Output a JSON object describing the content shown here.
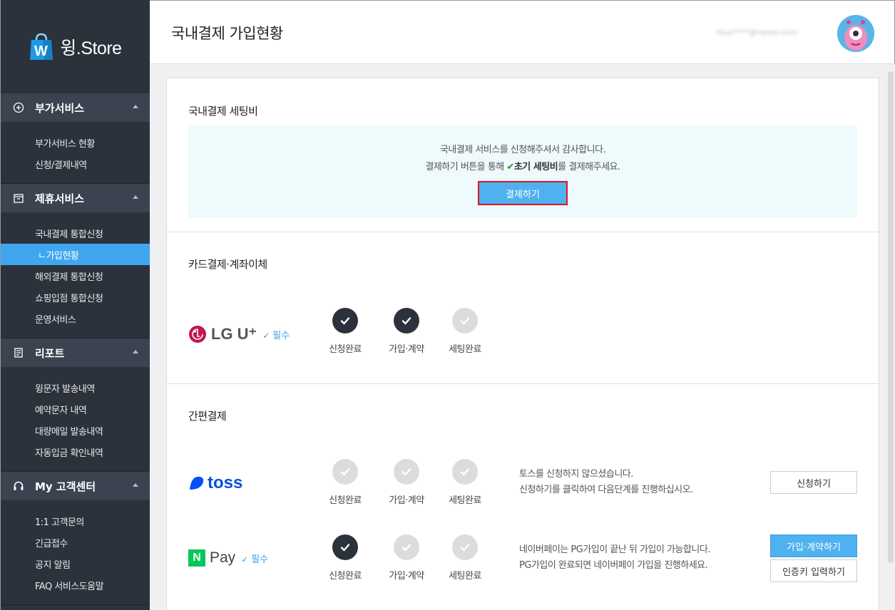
{
  "brand": {
    "name": "윙.Store",
    "bag_letter": "W"
  },
  "header": {
    "title": "국내결제 가입현황",
    "email": "hiuz****@naver.com"
  },
  "sidebar": {
    "sections": [
      {
        "title": "부가서비스",
        "icon": "plus-circle-icon",
        "items": [
          "부가서비스 현황",
          "신청/결제내역"
        ]
      },
      {
        "title": "제휴서비스",
        "icon": "box-icon",
        "items": [
          "국내결제 통합신청",
          "ㄴ가입현황",
          "해외결제 통합신청",
          "쇼핑입점 통합신청",
          "운영서비스"
        ],
        "active_index": 1
      },
      {
        "title": "리포트",
        "icon": "report-icon",
        "items": [
          "윙문자 발송내역",
          "예약문자 내역",
          "대량메일 발송내역",
          "자동입금 확인내역"
        ]
      },
      {
        "title": "My 고객센터",
        "icon": "headset-icon",
        "items": [
          "1:1 고객문의",
          "긴급접수",
          "공지 알림",
          "FAQ 서비스도움말"
        ]
      }
    ]
  },
  "setup": {
    "title": "국내결제 세팅비",
    "line1": "국내결제 서비스를 신청해주셔서 감사합니다.",
    "line2_pre": "결제하기 버튼을 통해 ",
    "line2_check": "✔",
    "line2_bold": "초기 세팅비",
    "line2_post": "를 결제해주세요.",
    "button": "결제하기"
  },
  "card": {
    "title": "카드결제·계좌이체",
    "provider": "LG U⁺",
    "required": "필수",
    "steps": [
      {
        "label": "신청완료",
        "done": true
      },
      {
        "label": "가입·계약",
        "done": true
      },
      {
        "label": "세팅완료",
        "done": false
      }
    ]
  },
  "simple": {
    "title": "간편결제",
    "toss": {
      "name": "toss",
      "steps": [
        {
          "label": "신청완료",
          "done": false
        },
        {
          "label": "가입·계약",
          "done": false
        },
        {
          "label": "세팅완료",
          "done": false
        }
      ],
      "desc1": "토스를 신청하지 않으셨습니다.",
      "desc2": "신청하기를 클릭하여 다음단계를 진행하십시오.",
      "button": "신청하기"
    },
    "npay": {
      "badge": "N",
      "name": "Pay",
      "required": "필수",
      "steps": [
        {
          "label": "신청완료",
          "done": true
        },
        {
          "label": "가입·계약",
          "done": false
        },
        {
          "label": "세팅완료",
          "done": false
        }
      ],
      "desc1": "네이버페이는 PG가입이 끝난 뒤 가입이 가능합니다.",
      "desc2": "PG가입이 완료되면 네이버페이 가입을 진행하세요.",
      "button_primary": "가입·계약하기",
      "button_secondary": "인증키 입력하기"
    }
  },
  "colors": {
    "sidebar": "#2c323c",
    "accent": "#4fb1ef",
    "highlight": "#e0161e"
  }
}
